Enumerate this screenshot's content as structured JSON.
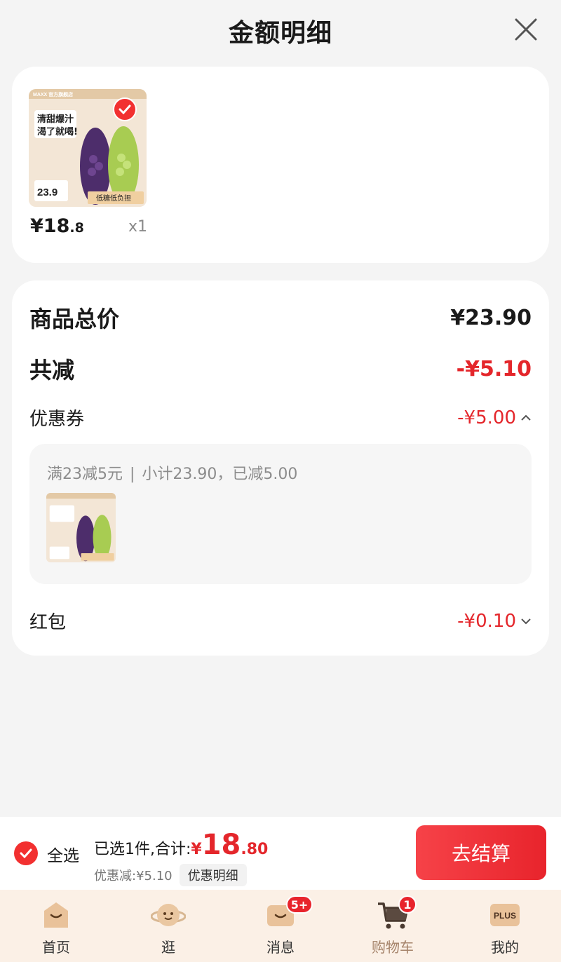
{
  "header": {
    "title": "金额明细"
  },
  "product": {
    "image_alt": "葡萄汽水商品图",
    "price_main": "¥18",
    "price_dec": ".8",
    "qty": "x1",
    "img_texts": {
      "brand": "MAXX 官方旗舰店",
      "slogan1": "清甜爆汁",
      "slogan2": "渴了就喝!",
      "price": "23.9",
      "tag": "低糖低负担"
    }
  },
  "summary": {
    "total_label": "商品总价",
    "total_value": "¥23.90",
    "reduce_label": "共减",
    "reduce_value": "-¥5.10",
    "coupon_label": "优惠券",
    "coupon_value": "-¥5.00",
    "coupon_detail_a": "满23减5元",
    "coupon_detail_sep": "|",
    "coupon_detail_b": "小计23.90，已减5.00",
    "redpack_label": "红包",
    "redpack_value": "-¥0.10"
  },
  "bottom": {
    "select_all": "全选",
    "selected_text": "已选1件,合计:",
    "total_yen": "¥",
    "total_int": "18",
    "total_dec": ".80",
    "discount_text": "优惠减:¥5.10",
    "detail_btn": "优惠明细",
    "checkout": "去结算"
  },
  "tabbar": {
    "items": [
      {
        "label": "首页",
        "icon": "home-icon"
      },
      {
        "label": "逛",
        "icon": "planet-face-icon"
      },
      {
        "label": "消息",
        "icon": "message-icon",
        "badge": "5+"
      },
      {
        "label": "购物车",
        "icon": "cart-icon",
        "badge": "1",
        "active": true
      },
      {
        "label": "我的",
        "icon": "plus-member-icon",
        "icon_text": "PLUS"
      }
    ]
  },
  "colors": {
    "accent_red": "#e4262b",
    "tab_bg": "#fbf0e6",
    "active_tab": "#a5836a"
  }
}
